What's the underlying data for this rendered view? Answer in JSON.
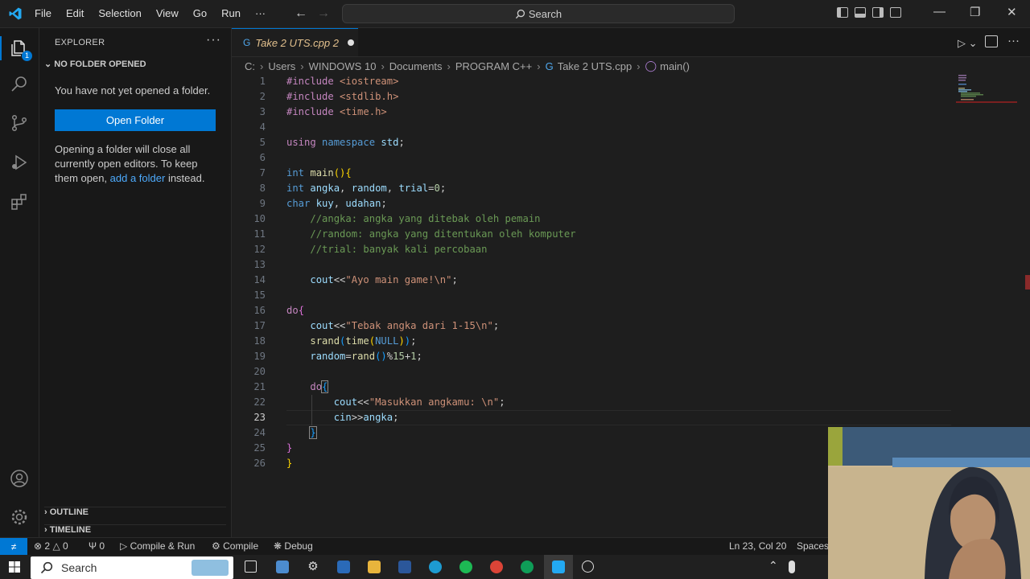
{
  "titlebar": {
    "menu": [
      "File",
      "Edit",
      "Selection",
      "View",
      "Go",
      "Run",
      "···"
    ],
    "search_label": "Search"
  },
  "sidebar": {
    "title": "EXPLORER",
    "section": "NO FOLDER OPENED",
    "message": "You have not yet opened a folder.",
    "open_button": "Open Folder",
    "note_before": "Opening a folder will close all currently open editors. To keep them open, ",
    "note_link": "add a folder",
    "note_after": " instead.",
    "outline": "OUTLINE",
    "timeline": "TIMELINE"
  },
  "activitybar": {
    "explorer_badge": "1"
  },
  "tab": {
    "label": "Take 2 UTS.cpp 2"
  },
  "breadcrumb": [
    "C:",
    "Users",
    "WINDOWS 10",
    "Documents",
    "PROGRAM C++",
    "Take 2 UTS.cpp",
    "main()"
  ],
  "editor": {
    "current_line": 23,
    "line_numbers": [
      "1",
      "2",
      "3",
      "4",
      "5",
      "6",
      "7",
      "8",
      "9",
      "10",
      "11",
      "12",
      "13",
      "14",
      "15",
      "16",
      "17",
      "18",
      "19",
      "20",
      "21",
      "22",
      "23",
      "24",
      "25",
      "26"
    ]
  },
  "statusbar": {
    "errors": "2",
    "warnings": "0",
    "ports": "0",
    "compile_run": "Compile & Run",
    "compile": "Compile",
    "debug": "Debug",
    "position": "Ln 23, Col 20",
    "spaces": "Spaces:"
  },
  "taskbar": {
    "search_label": "Search"
  },
  "colors": {
    "accent": "#0078d4",
    "editor_bg": "#1e1e1e",
    "sidebar_bg": "#181818"
  }
}
